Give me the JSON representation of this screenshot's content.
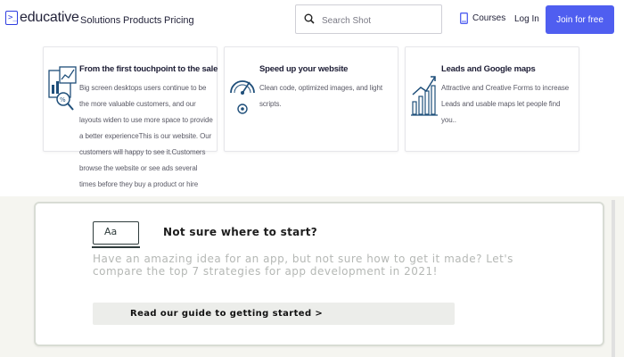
{
  "header": {
    "logo_text": "educative",
    "logo_glyph": ">_",
    "nav_links": [
      {
        "label": "Solutions"
      },
      {
        "label": "Products"
      },
      {
        "label": "Pricing"
      }
    ],
    "search": {
      "placeholder": "Search Shot",
      "value": ""
    },
    "courses_label": "Courses",
    "login_label": "Log In",
    "join_label": "Join for free",
    "accent_color": "#4f5ef0"
  },
  "cards": [
    {
      "title": "From the first touchpoint to the sale",
      "body": "Big screen desktops users continue to be the more valuable customers, and our layouts widen to use more space to provide a better experienceThis is our website. Our customers will happy to see it.Customers browse the website or see ads several times before they buy a product or hire your company. Let's help them in the user journey.",
      "icon": "analytics-magnifier-icon"
    },
    {
      "title": "Speed up your website",
      "body": "Clean code, optimized images, and light scripts.",
      "icon": "speedometer-icon"
    },
    {
      "title": "Leads and Google maps",
      "body": "Attractive and Creative Forms to increase Leads and usable maps let people find you..",
      "icon": "growth-chart-icon"
    }
  ],
  "guide": {
    "icon_text": "Aa",
    "title": "Not sure where to start?",
    "body": "Have an amazing idea for an app, but not sure how to get it made? Let's compare the top 7 strategies for app development in 2021!",
    "button_label": "Read our guide to getting started >"
  }
}
